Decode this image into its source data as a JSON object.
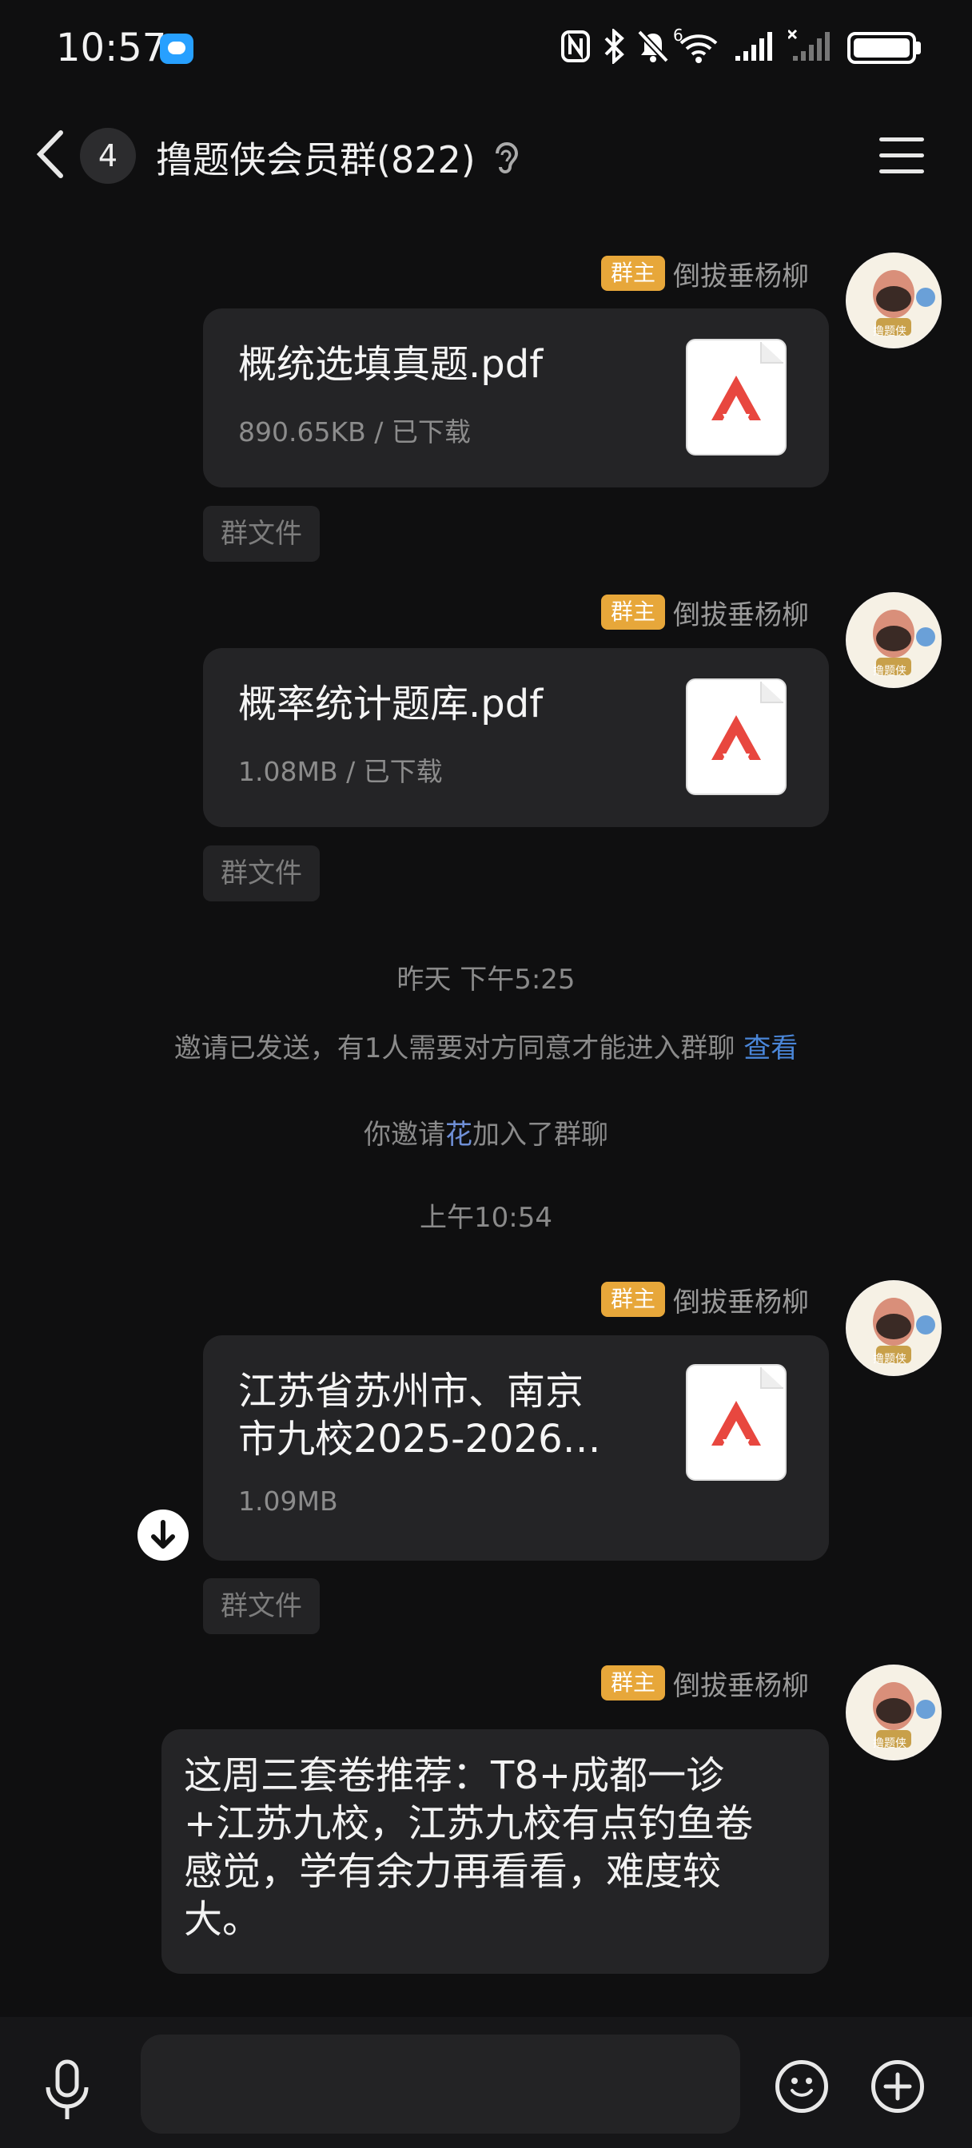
{
  "status_bar": {
    "time": "10:57",
    "icons": [
      "message-notification-icon",
      "nfc-icon",
      "bluetooth-icon",
      "mute-icon",
      "wifi-icon",
      "signal-icon",
      "signal-icon-2",
      "battery-icon"
    ],
    "wifi_tag": "6"
  },
  "header": {
    "unread_count": "4",
    "title": "撸题侠会员群(822)",
    "icons": [
      "back-icon",
      "ear-icon",
      "menu-icon"
    ]
  },
  "messages": [
    {
      "owner_tag": "群主",
      "sender": "倒拔垂杨柳",
      "file_name": "概统选填真题.pdf",
      "meta": "890.65KB / 已下载",
      "label": "群文件"
    },
    {
      "owner_tag": "群主",
      "sender": "倒拔垂杨柳",
      "file_name": "概率统计题库.pdf",
      "meta": "1.08MB / 已下载",
      "label": "群文件"
    },
    {
      "owner_tag": "群主",
      "sender": "倒拔垂杨柳",
      "file_name_line1": "江苏省苏州市、南京",
      "file_name_line2": "市九校2025-2026…",
      "meta": "1.09MB",
      "label": "群文件"
    },
    {
      "owner_tag": "群主",
      "sender": "倒拔垂杨柳",
      "text_lines": [
        "这周三套卷推荐：T8+成都一诊",
        "+江苏九校，江苏九校有点钓鱼卷",
        "感觉，学有余力再看看，难度较",
        "大。"
      ]
    }
  ],
  "system": {
    "timestamp1": "昨天 下午5:25",
    "invite_text": "邀请已发送，有1人需要对方同意才能进入群聊",
    "invite_link": "查看",
    "join_prefix": "你邀请",
    "join_name": "花",
    "join_suffix": "加入了群聊",
    "timestamp2": "上午10:54"
  },
  "avatar_text": "撸题侠",
  "colors": {
    "background": "#0f0f10",
    "owner_tag": "#e7a73a",
    "link": "#4a86d8",
    "bubble": "#242426",
    "pdf_red": "#e8473f"
  }
}
